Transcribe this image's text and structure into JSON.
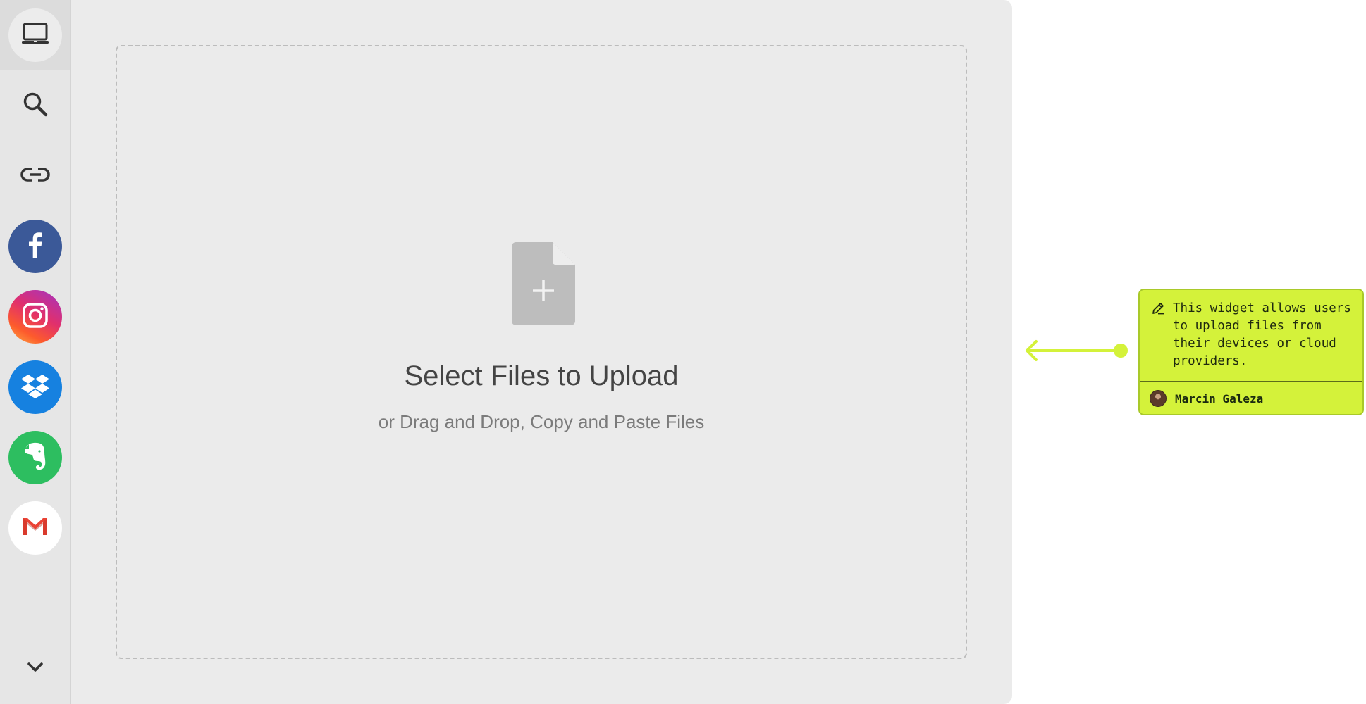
{
  "sidebar": {
    "items": [
      {
        "name": "my-device",
        "icon": "laptop-icon",
        "active": true
      },
      {
        "name": "search",
        "icon": "search-icon"
      },
      {
        "name": "link",
        "icon": "link-icon"
      },
      {
        "name": "facebook",
        "icon": "facebook-icon",
        "color": "#3b5998"
      },
      {
        "name": "instagram",
        "icon": "instagram-icon",
        "color": "#e1306c"
      },
      {
        "name": "dropbox",
        "icon": "dropbox-icon",
        "color": "#1681e0"
      },
      {
        "name": "evernote",
        "icon": "evernote-icon",
        "color": "#2dbe60"
      },
      {
        "name": "gmail",
        "icon": "gmail-icon",
        "color": "#ffffff"
      }
    ],
    "more_icon": "chevron-down-icon"
  },
  "dropzone": {
    "icon": "file-plus-icon",
    "title": "Select Files to Upload",
    "subtitle": "or Drag and Drop, Copy and Paste Files"
  },
  "annotation": {
    "icon": "pencil-icon",
    "text": "This widget allows users to upload files from their devices or cloud providers.",
    "author": "Marcin Galeza",
    "accent": "#d4f23a"
  }
}
